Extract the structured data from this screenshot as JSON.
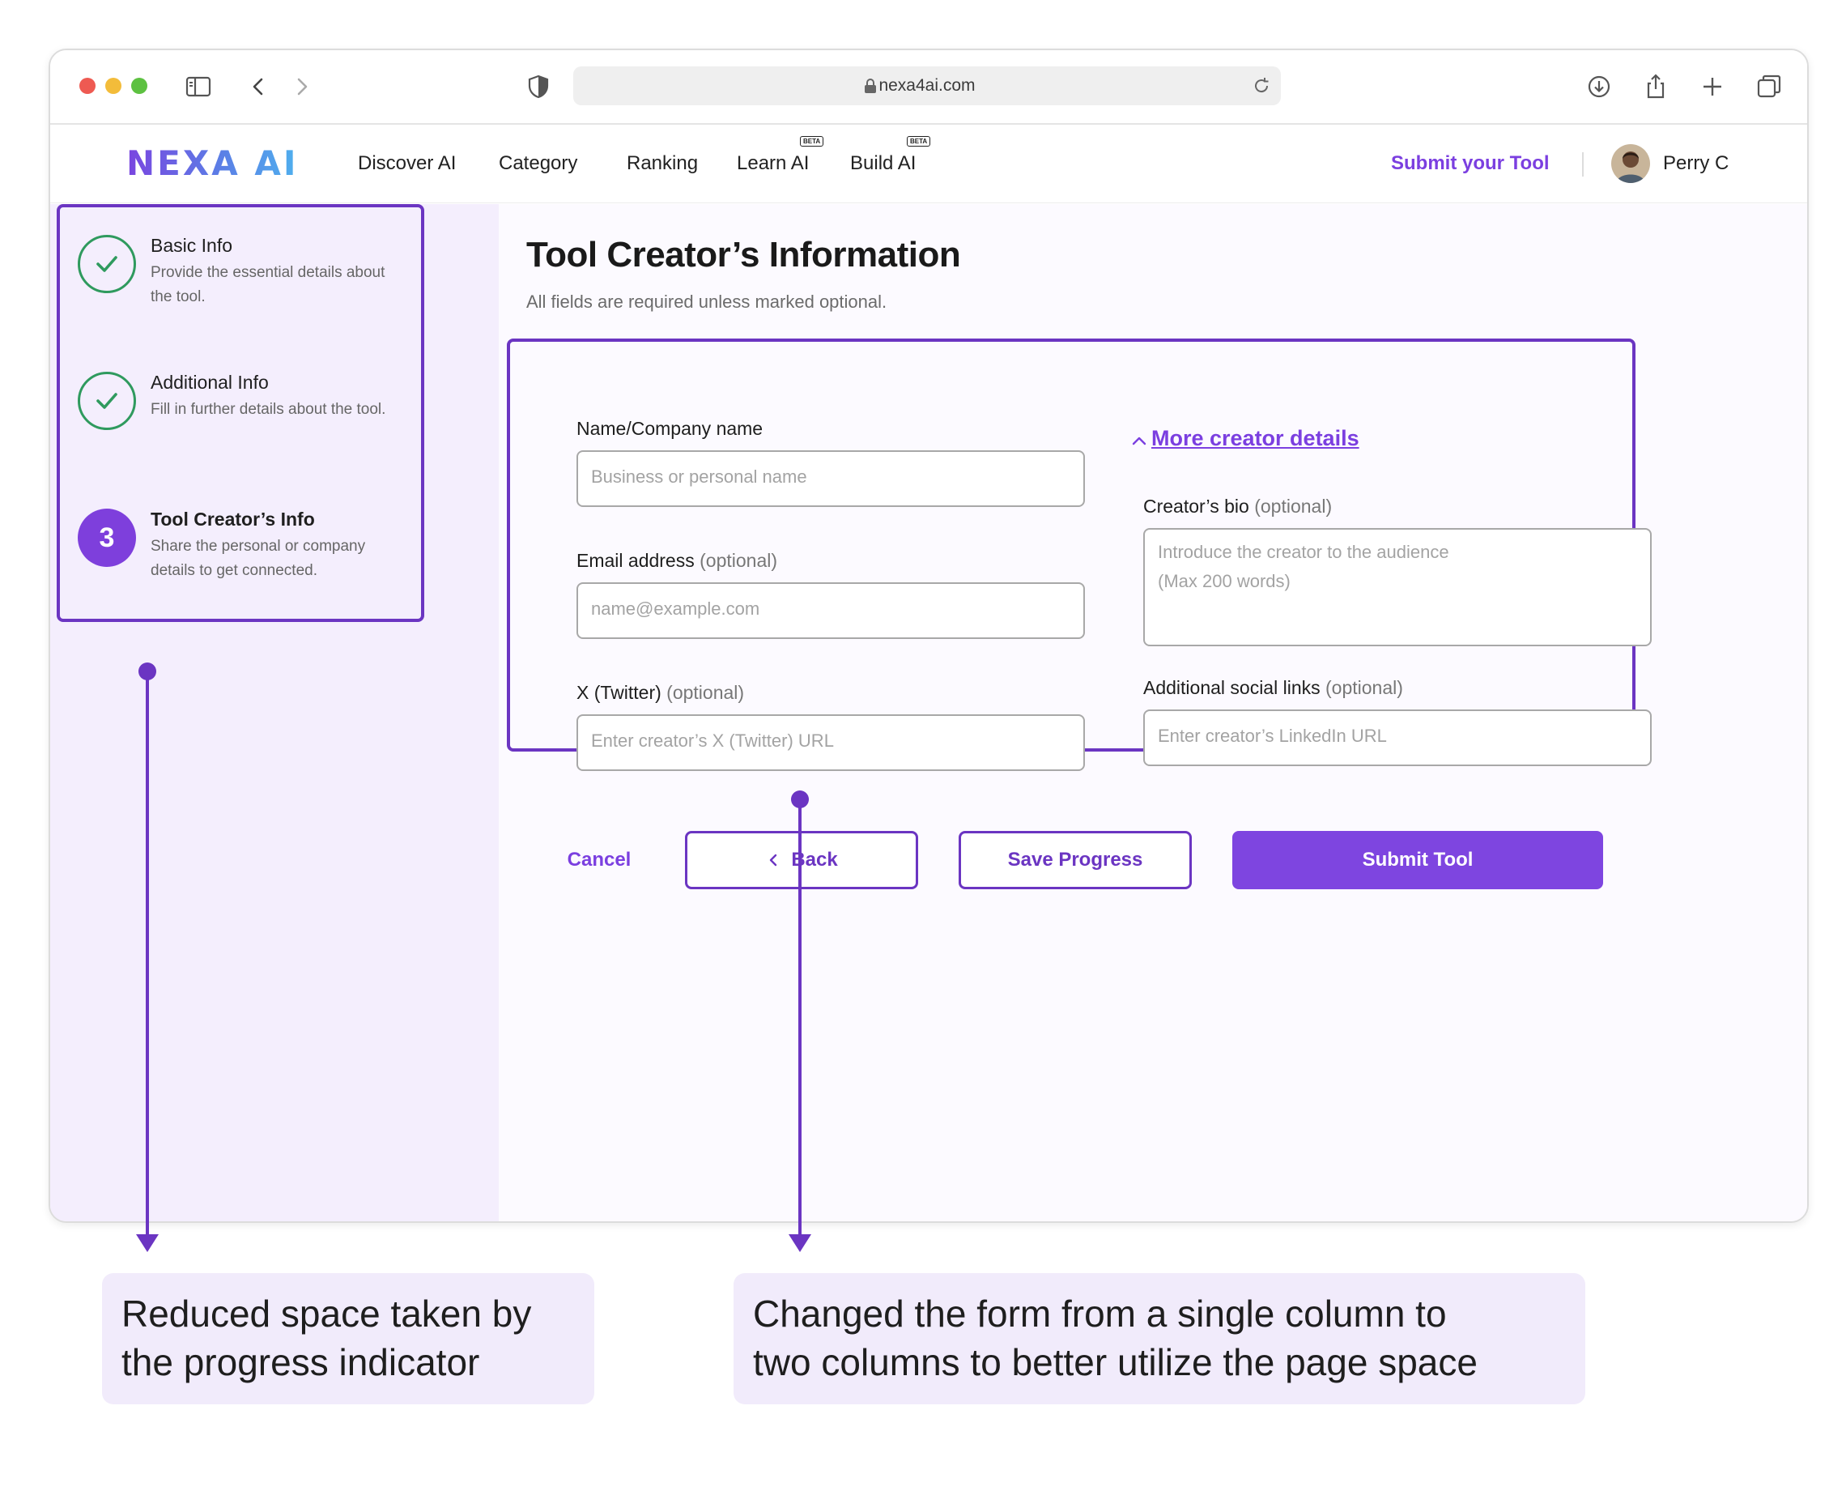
{
  "browser": {
    "url": "nexa4ai.com"
  },
  "nav": {
    "logo_text": "NEXA AI",
    "links": [
      {
        "label": "Discover AI",
        "beta": ""
      },
      {
        "label": "Category",
        "beta": ""
      },
      {
        "label": "Ranking",
        "beta": ""
      },
      {
        "label": "Learn AI",
        "beta": "BETA"
      },
      {
        "label": "Build AI",
        "beta": "BETA"
      }
    ],
    "submit_label": "Submit your Tool",
    "user_name": "Perry C"
  },
  "steps": [
    {
      "title": "Basic Info",
      "desc": "Provide the essential details about the tool.",
      "status": "complete"
    },
    {
      "title": "Additional Info",
      "desc": "Fill in further details about the tool.",
      "status": "complete"
    },
    {
      "number": "3",
      "title": "Tool Creator’s Info",
      "desc": "Share the personal or company details to get connected.",
      "status": "current"
    }
  ],
  "page": {
    "title": "Tool Creator’s Information",
    "subtitle": "All fields are required unless marked optional."
  },
  "form": {
    "name": {
      "label": "Name/Company name",
      "placeholder": "Business or personal name"
    },
    "email": {
      "label": "Email address",
      "optional": "(optional)",
      "placeholder": "name@example.com"
    },
    "twitter": {
      "label": "X (Twitter)",
      "optional": "(optional)",
      "placeholder": "Enter creator’s X (Twitter) URL"
    },
    "more_details": "More creator details",
    "bio": {
      "label": "Creator’s bio",
      "optional": "(optional)",
      "placeholder_line1": "Introduce the creator to the audience",
      "placeholder_line2": "(Max 200 words)"
    },
    "social": {
      "label": "Additional social links",
      "optional": "(optional)",
      "placeholder": "Enter creator’s LinkedIn URL"
    }
  },
  "actions": {
    "cancel": "Cancel",
    "back": "Back",
    "save": "Save Progress",
    "submit": "Submit Tool"
  },
  "annotations": {
    "left_line1": "Reduced space taken by",
    "left_line2": "the progress indicator",
    "right_line1": "Changed the form from a single column to",
    "right_line2": "two columns to better utilize the page space"
  },
  "colors": {
    "accent": "#7b3fe0",
    "annotation": "#6b35c2",
    "complete": "#2f9a5e",
    "sidebar_bg": "#f4eefd"
  }
}
